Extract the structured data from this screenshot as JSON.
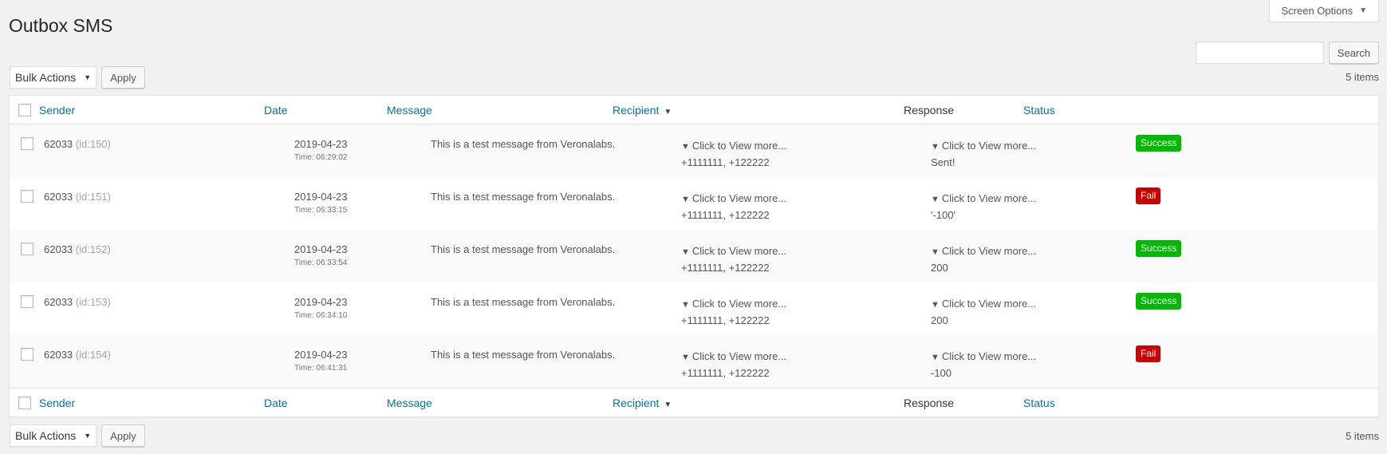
{
  "screen_options": {
    "label": "Screen Options"
  },
  "page": {
    "title": "Outbox SMS"
  },
  "search": {
    "button_label": "Search",
    "value": ""
  },
  "bulk": {
    "select_label": "Bulk Actions",
    "apply_label": "Apply"
  },
  "items_count": "5 items",
  "columns": {
    "sender": "Sender",
    "date": "Date",
    "message": "Message",
    "recipient": "Recipient",
    "response": "Response",
    "status": "Status"
  },
  "rows": [
    {
      "sender": "62033",
      "id": "(id:150)",
      "date": "2019-04-23",
      "time": "Time: 06:29:02",
      "message": "This is a test message from Veronalabs.",
      "recipient_toggle": "Click to View more...",
      "recipients": "+1111111, +122222",
      "response_toggle": "Click to View more...",
      "response": "Sent!",
      "status": "Success",
      "status_color": "#00b900"
    },
    {
      "sender": "62033",
      "id": "(id:151)",
      "date": "2019-04-23",
      "time": "Time: 06:33:15",
      "message": "This is a test message from Veronalabs.",
      "recipient_toggle": "Click to View more...",
      "recipients": "+1111111, +122222",
      "response_toggle": "Click to View more...",
      "response": "'-100'",
      "status": "Fail",
      "status_color": "#c80000"
    },
    {
      "sender": "62033",
      "id": "(id:152)",
      "date": "2019-04-23",
      "time": "Time: 06:33:54",
      "message": "This is a test message from Veronalabs.",
      "recipient_toggle": "Click to View more...",
      "recipients": "+1111111, +122222",
      "response_toggle": "Click to View more...",
      "response": "200",
      "status": "Success",
      "status_color": "#00b900"
    },
    {
      "sender": "62033",
      "id": "(id:153)",
      "date": "2019-04-23",
      "time": "Time: 06:34:10",
      "message": "This is a test message from Veronalabs.",
      "recipient_toggle": "Click to View more...",
      "recipients": "+1111111, +122222",
      "response_toggle": "Click to View more...",
      "response": "200",
      "status": "Success",
      "status_color": "#00b900"
    },
    {
      "sender": "62033",
      "id": "(id:154)",
      "date": "2019-04-23",
      "time": "Time: 06:41:31",
      "message": "This is a test message from Veronalabs.",
      "recipient_toggle": "Click to View more...",
      "recipients": "+1111111, +122222",
      "response_toggle": "Click to View more...",
      "response": "-100",
      "status": "Fail",
      "status_color": "#c80000"
    }
  ],
  "colors": {
    "link": "#0073aa",
    "success": "#00b900",
    "fail": "#c80000"
  },
  "icons": {
    "sort": "caret-down-icon",
    "expand": "triangle-down-icon",
    "screen_options": "caret-down-icon"
  }
}
